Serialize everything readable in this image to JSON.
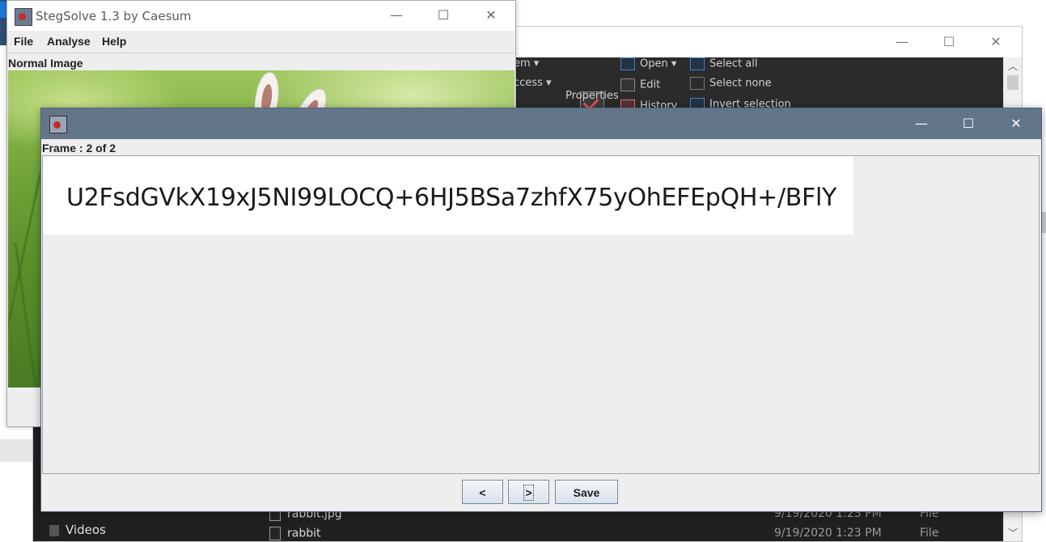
{
  "explorer": {
    "ribbon": {
      "item_suffix": "em",
      "access_suffix": "ccess",
      "open_label": "Open",
      "edit_label": "Edit",
      "history_label": "History",
      "properties_label": "Properties",
      "select_all_label": "Select all",
      "select_none_label": "Select none",
      "invert_selection_label": "Invert selection"
    },
    "nav": {
      "videos_label": "Videos"
    },
    "files": [
      {
        "name": "rabbit.jpg",
        "date": "9/19/2020 1:23 PM",
        "type": "File"
      },
      {
        "name": "rabbit",
        "date": "9/19/2020 1:23 PM",
        "type": "File"
      }
    ]
  },
  "stegsolve": {
    "title": "StegSolve 1.3 by Caesum",
    "menu": [
      "File",
      "Analyse",
      "Help"
    ],
    "image_label": "Normal Image"
  },
  "dialog": {
    "frame_label": "Frame : 2 of 2",
    "ciphertext": "U2FsdGVkX19xJ5NI99LOCQ+6HJ5BSa7zhfX75yOhEFEpQH+/BFlY",
    "buttons": {
      "prev_label": "<",
      "next_label": ">",
      "save_label": "Save"
    }
  },
  "window_controls": {
    "minimize": "—",
    "maximize": "☐",
    "close": "✕"
  }
}
